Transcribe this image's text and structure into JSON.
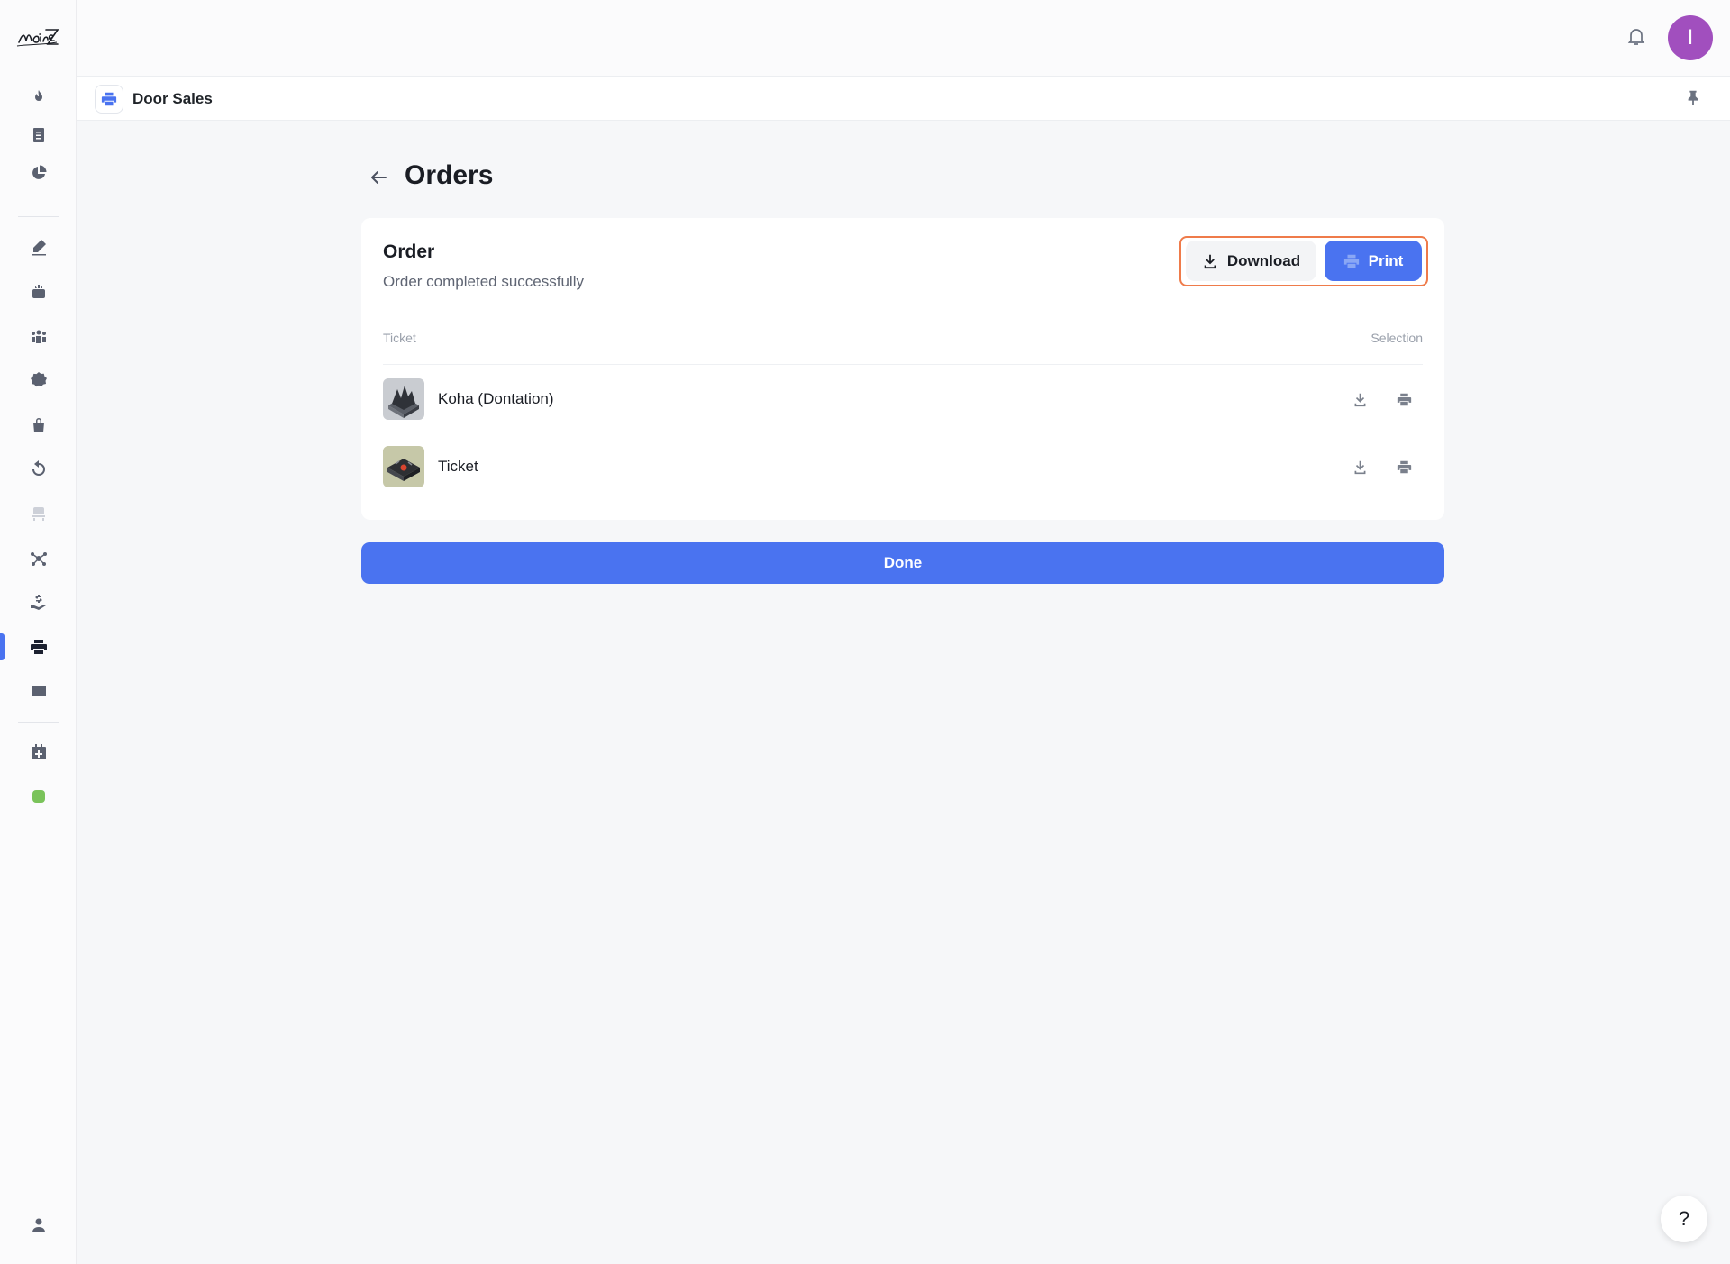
{
  "app": {
    "logo_text": "NoiseZ",
    "status_color": "#7ac35a",
    "accent_color": "#4a73f0"
  },
  "sidebar": {
    "items": [
      {
        "icon": "fire-icon"
      },
      {
        "icon": "document-icon"
      },
      {
        "icon": "pie-chart-icon"
      },
      {
        "icon": "edit-pencil-icon"
      },
      {
        "icon": "robot-icon"
      },
      {
        "icon": "group-icon"
      },
      {
        "icon": "discount-badge-icon"
      },
      {
        "icon": "shopping-bag-icon"
      },
      {
        "icon": "refund-icon"
      },
      {
        "icon": "seat-icon"
      },
      {
        "icon": "network-icon"
      },
      {
        "icon": "payout-hand-icon"
      },
      {
        "icon": "printer-icon",
        "active": true
      },
      {
        "icon": "mail-icon"
      },
      {
        "icon": "calendar-add-icon"
      },
      {
        "icon": "status-dot-icon"
      },
      {
        "icon": "user-icon"
      }
    ]
  },
  "header": {
    "avatar_initial": "I",
    "avatar_color": "#a14fbe"
  },
  "subheader": {
    "title": "Door Sales"
  },
  "page": {
    "title": "Orders"
  },
  "order": {
    "title": "Order",
    "subtitle": "Order completed successfully",
    "download_label": "Download",
    "print_label": "Print",
    "columns": {
      "ticket": "Ticket",
      "selection": "Selection"
    },
    "tickets": [
      {
        "name": "Koha (Dontation)"
      },
      {
        "name": "Ticket"
      }
    ]
  },
  "footer": {
    "done_label": "Done",
    "help_label": "?"
  }
}
